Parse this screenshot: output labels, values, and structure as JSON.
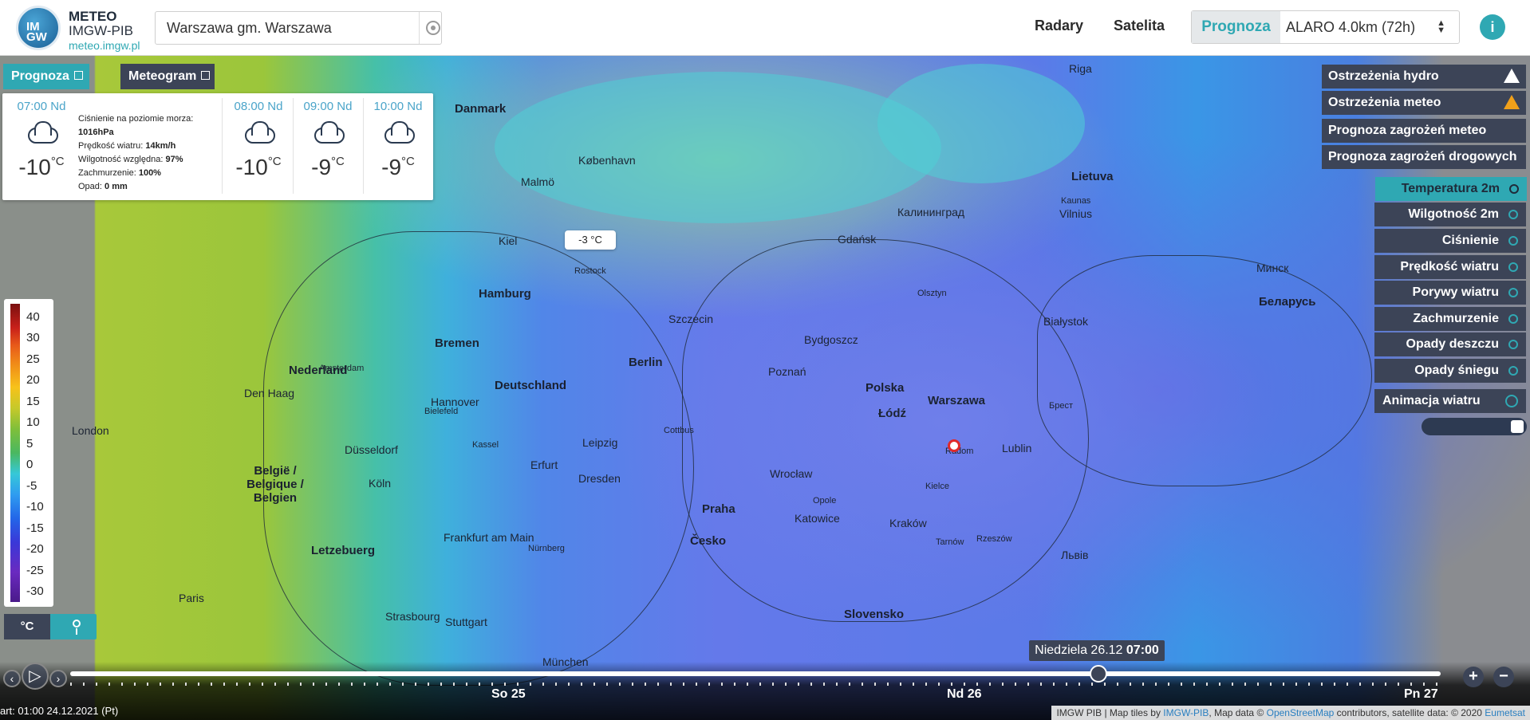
{
  "header": {
    "logo_text": "IM GW",
    "brand_line1": "METEO",
    "brand_line2": "IMGW-PIB",
    "brand_line3": "meteo.imgw.pl",
    "search_value": "Warszawa gm. Warszawa",
    "nav": [
      "Radary",
      "Satelita"
    ],
    "prognoza_label": "Prognoza",
    "model_select": "ALARO 4.0km (72h)",
    "info_label": "i"
  },
  "tabs": {
    "prognoza": "Prognoza",
    "meteogram": "Meteogram"
  },
  "forecast": {
    "current": {
      "time": "07:00 Nd",
      "temp": "-10",
      "unit": "°C",
      "pressure_label": "Ciśnienie na poziomie morza:",
      "pressure_value": "1016hPa",
      "wind_label": "Prędkość wiatru:",
      "wind_value": "14km/h",
      "humidity_label": "Wilgotność względna:",
      "humidity_value": "97%",
      "cloud_label": "Zachmurzenie:",
      "cloud_value": "100%",
      "precip_label": "Opad:",
      "precip_value": "0 mm"
    },
    "hours": [
      {
        "time": "08:00 Nd",
        "temp": "-10",
        "unit": "°C"
      },
      {
        "time": "09:00 Nd",
        "temp": "-9",
        "unit": "°C"
      },
      {
        "time": "10:00 Nd",
        "temp": "-9",
        "unit": "°C"
      }
    ]
  },
  "map": {
    "temp_tooltip": "-3 °C",
    "countries": [
      "Danmark",
      "Deutschland",
      "Nederland",
      "Polska",
      "Lietuva",
      "Беларусь",
      "Česko",
      "Slovensko",
      "België / Belgique / Belgien",
      "Letzebuerg"
    ],
    "cities": [
      "Malmö",
      "København",
      "Hamburg",
      "Berlin",
      "Warszawa",
      "Gdańsk",
      "Poznań",
      "Wrocław",
      "Kraków",
      "Łódź",
      "Lublin",
      "Białystok",
      "Szczecin",
      "Bydgoszcz",
      "Katowice",
      "Leipzig",
      "Dresden",
      "Praha",
      "Vilnius",
      "Kaunas",
      "Riga",
      "Минск",
      "Брест",
      "Львів",
      "Калининград",
      "London",
      "Paris",
      "Bremen",
      "Düsseldorf",
      "Köln",
      "Frankfurt am Main",
      "Erfurt",
      "Den Haag",
      "Amsterdam",
      "Hannover",
      "Kiel",
      "Rostock",
      "Olsztyn",
      "Kielce",
      "Radom",
      "Opole",
      "Rzeszów",
      "Tarnów",
      "Cottbus",
      "Stuttgart",
      "Strasbourg",
      "München",
      "Nürnberg",
      "Kassel",
      "Bielefeld"
    ]
  },
  "legend": {
    "labels": [
      "40",
      "30",
      "25",
      "20",
      "15",
      "10",
      "5",
      "0",
      "-5",
      "-10",
      "-15",
      "-20",
      "-25",
      "-30"
    ],
    "unit_button": "°C"
  },
  "warnings": [
    {
      "label": "Ostrzeżenia hydro"
    },
    {
      "label": "Ostrzeżenia meteo"
    },
    {
      "label": "Prognoza zagrożeń meteo"
    },
    {
      "label": "Prognoza zagrożeń drogowych"
    }
  ],
  "layers": [
    "Temperatura 2m",
    "Wilgotność 2m",
    "Ciśnienie",
    "Prędkość wiatru",
    "Porywy wiatru",
    "Zachmurzenie",
    "Opady deszczu",
    "Opady śniegu"
  ],
  "animation_label": "Animacja wiatru",
  "timeline": {
    "tooltip_day": "Niedziela 26.12",
    "tooltip_time": "07:00",
    "days": [
      "So 25",
      "Nd 26",
      "Pn 27"
    ],
    "progress": 0.75,
    "start_label": "art: 01:00 24.12.2021 (Pt)",
    "zoom_in": "+",
    "zoom_out": "−"
  },
  "attribution": {
    "prefix": "IMGW PIB | Map tiles by ",
    "link1": "IMGW-PIB",
    "mid": ", Map data © ",
    "link2": "OpenStreetMap",
    "suffix": " contributors, satellite data: © 2020 ",
    "link3": "Eumetsat"
  }
}
